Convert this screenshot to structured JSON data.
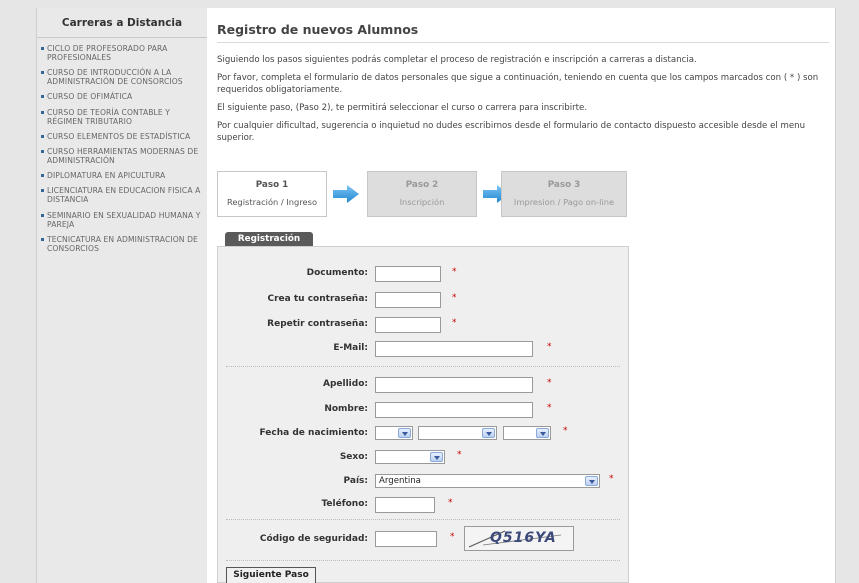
{
  "sidebar": {
    "title": "Carreras a Distancia",
    "items": [
      "CICLO DE PROFESORADO PARA PROFESIONALES",
      "CURSO DE INTRODUCCIÓN A LA ADMINISTRACIÓN DE CONSORCIOS",
      "CURSO DE OFIMÁTICA",
      "CURSO DE TEORÍA CONTABLE Y RÉGIMEN TRIBUTARIO",
      "CURSO ELEMENTOS DE ESTADÍSTICA",
      "CURSO HERRAMIENTAS MODERNAS DE ADMINISTRACIÓN",
      "DIPLOMATURA EN APICULTURA",
      "LICENCIATURA EN EDUCACION FISICA A DISTANCIA",
      "SEMINARIO EN SEXUALIDAD HUMANA Y PAREJA",
      "TECNICATURA EN ADMINISTRACION DE CONSORCIOS"
    ]
  },
  "main": {
    "heading": "Registro de nuevos Alumnos",
    "intro": [
      "Siguiendo los pasos siguientes podrás completar el proceso de registración e inscripción a carreras a distancia.",
      "Por favor, completa el formulario de datos personales que sigue a continuación, teniendo en cuenta que los campos marcados con ( * ) son requeridos obligatoriamente.",
      "El siguiente paso, (Paso 2), te permitirá seleccionar el curso o carrera para inscribirte.",
      "Por cualquier dificultad, sugerencia o inquietud no dudes escribirnos desde el formulario de contacto dispuesto accesible desde el menu superior."
    ],
    "steps": [
      {
        "title": "Paso 1",
        "subtitle": "Registración / Ingreso",
        "active": true
      },
      {
        "title": "Paso 2",
        "subtitle": "Inscripción",
        "active": false
      },
      {
        "title": "Paso 3",
        "subtitle": "Impresion / Pago on-line",
        "active": false
      }
    ]
  },
  "form": {
    "tab_label": "Registración",
    "required_mark": "*",
    "labels": {
      "documento": "Documento:",
      "password": "Crea tu contraseña:",
      "password_repeat": "Repetir contraseña:",
      "email": "E-Mail:",
      "apellido": "Apellido:",
      "nombre": "Nombre:",
      "fecha_nacimiento": "Fecha de nacimiento:",
      "sexo": "Sexo:",
      "pais": "País:",
      "telefono": "Teléfono:",
      "codigo_seguridad": "Código de seguridad:"
    },
    "values": {
      "documento": "",
      "password": "",
      "password_repeat": "",
      "email": "",
      "apellido": "",
      "nombre": "",
      "dia": "",
      "mes": "",
      "anio": "",
      "sexo": "",
      "pais": "Argentina",
      "telefono": "",
      "codigo_seguridad": ""
    },
    "captcha_text": "Q516YA",
    "submit_label": "Siguiente Paso"
  },
  "colors": {
    "bullet": "#336699",
    "required": "#cc0000",
    "arrow": "#3399dd",
    "tab_bg": "#5a5a5a"
  }
}
